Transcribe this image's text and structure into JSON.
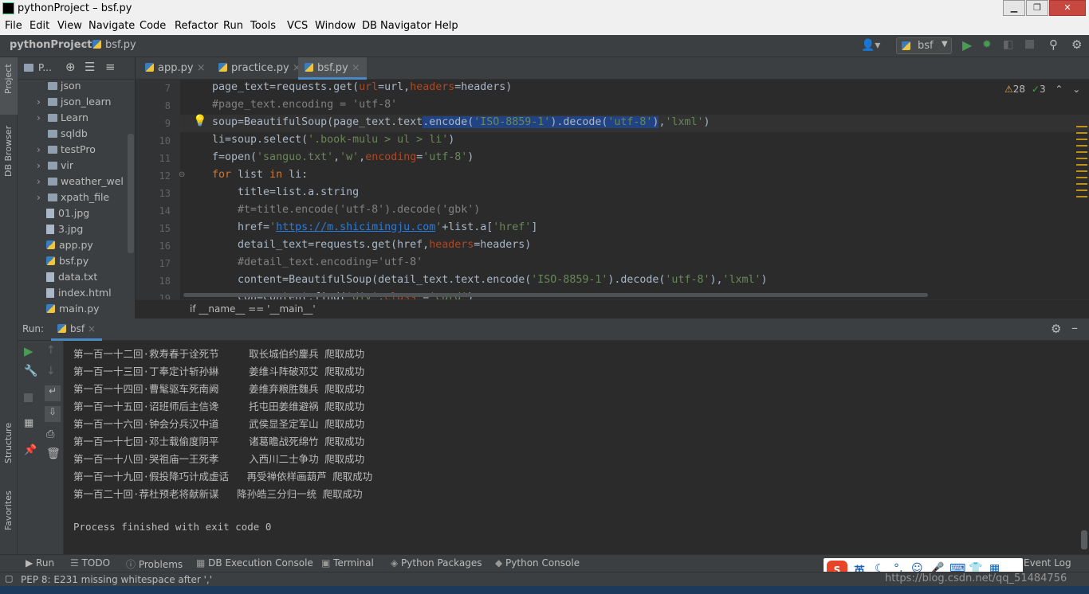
{
  "window": {
    "title": "pythonProject – bsf.py",
    "min": "▁",
    "max": "❐",
    "close": "✕"
  },
  "menu": [
    "File",
    "Edit",
    "View",
    "Navigate",
    "Code",
    "Refactor",
    "Run",
    "Tools",
    "VCS",
    "Window",
    "DB Navigator",
    "Help"
  ],
  "breadcrumb": {
    "project": "pythonProject",
    "file": "bsf.py"
  },
  "run_config": "bsf",
  "left_strip": {
    "project": "Project",
    "db": "DB Browser",
    "structure": "Structure",
    "favorites": "Favorites"
  },
  "project_panel": {
    "label": "P...",
    "items": [
      {
        "name": "json",
        "kind": "folder",
        "arrow": ""
      },
      {
        "name": "json_learn",
        "kind": "folder",
        "arrow": "›"
      },
      {
        "name": "Learn",
        "kind": "folder",
        "arrow": "›"
      },
      {
        "name": "sqldb",
        "kind": "folder",
        "arrow": ""
      },
      {
        "name": "testPro",
        "kind": "folder",
        "arrow": "›"
      },
      {
        "name": "vir",
        "kind": "folder",
        "arrow": "›"
      },
      {
        "name": "weather_wel",
        "kind": "folder",
        "arrow": "›"
      },
      {
        "name": "xpath_file",
        "kind": "folder",
        "arrow": "›"
      },
      {
        "name": "01.jpg",
        "kind": "file",
        "arrow": ""
      },
      {
        "name": "3.jpg",
        "kind": "file",
        "arrow": ""
      },
      {
        "name": "app.py",
        "kind": "py",
        "arrow": ""
      },
      {
        "name": "bsf.py",
        "kind": "py",
        "arrow": ""
      },
      {
        "name": "data.txt",
        "kind": "file",
        "arrow": ""
      },
      {
        "name": "index.html",
        "kind": "file",
        "arrow": ""
      },
      {
        "name": "main.py",
        "kind": "py",
        "arrow": ""
      }
    ]
  },
  "tabs": [
    {
      "label": "app.py",
      "active": false
    },
    {
      "label": "practice.py",
      "active": false
    },
    {
      "label": "bsf.py",
      "active": true
    }
  ],
  "inspections": {
    "warnings": "28",
    "ok": "3"
  },
  "line_numbers": [
    "7",
    "8",
    "9",
    "10",
    "11",
    "12",
    "13",
    "14",
    "15",
    "16",
    "17",
    "18",
    "19"
  ],
  "code_breadcrumb": "if __name__ == '__main__'",
  "run_panel": {
    "label": "Run:",
    "tab": "bsf",
    "output": [
      "第一百一十二回·救寿春于诠死节     取长城伯约鏖兵 爬取成功",
      "第一百一十三回·丁奉定计斩孙綝     姜维斗阵破邓艾 爬取成功",
      "第一百一十四回·曹髦驱车死南阙     姜维弃粮胜魏兵 爬取成功",
      "第一百一十五回·诏班师后主信谗     托屯田姜维避祸 爬取成功",
      "第一百一十六回·钟会分兵汉中道     武侯显圣定军山 爬取成功",
      "第一百一十七回·邓士载偷度阴平     诸葛瞻战死绵竹 爬取成功",
      "第一百一十八回·哭祖庙一王死孝     入西川二士争功 爬取成功",
      "第一百一十九回·假投降巧计成虚话   再受禅依样画葫芦 爬取成功",
      "第一百二十回·荐杜预老将献新谋   降孙皓三分归一统 爬取成功",
      "",
      "Process finished with exit code 0"
    ]
  },
  "bottom_tabs": [
    "Run",
    "TODO",
    "Problems",
    "DB Execution Console",
    "Terminal",
    "Python Packages",
    "Python Console"
  ],
  "event_log": "Event Log",
  "status": "PEP 8: E231 missing whitespace after ','",
  "ime": {
    "lang": "英"
  },
  "watermark": "https://blog.csdn.net/qq_51484756"
}
